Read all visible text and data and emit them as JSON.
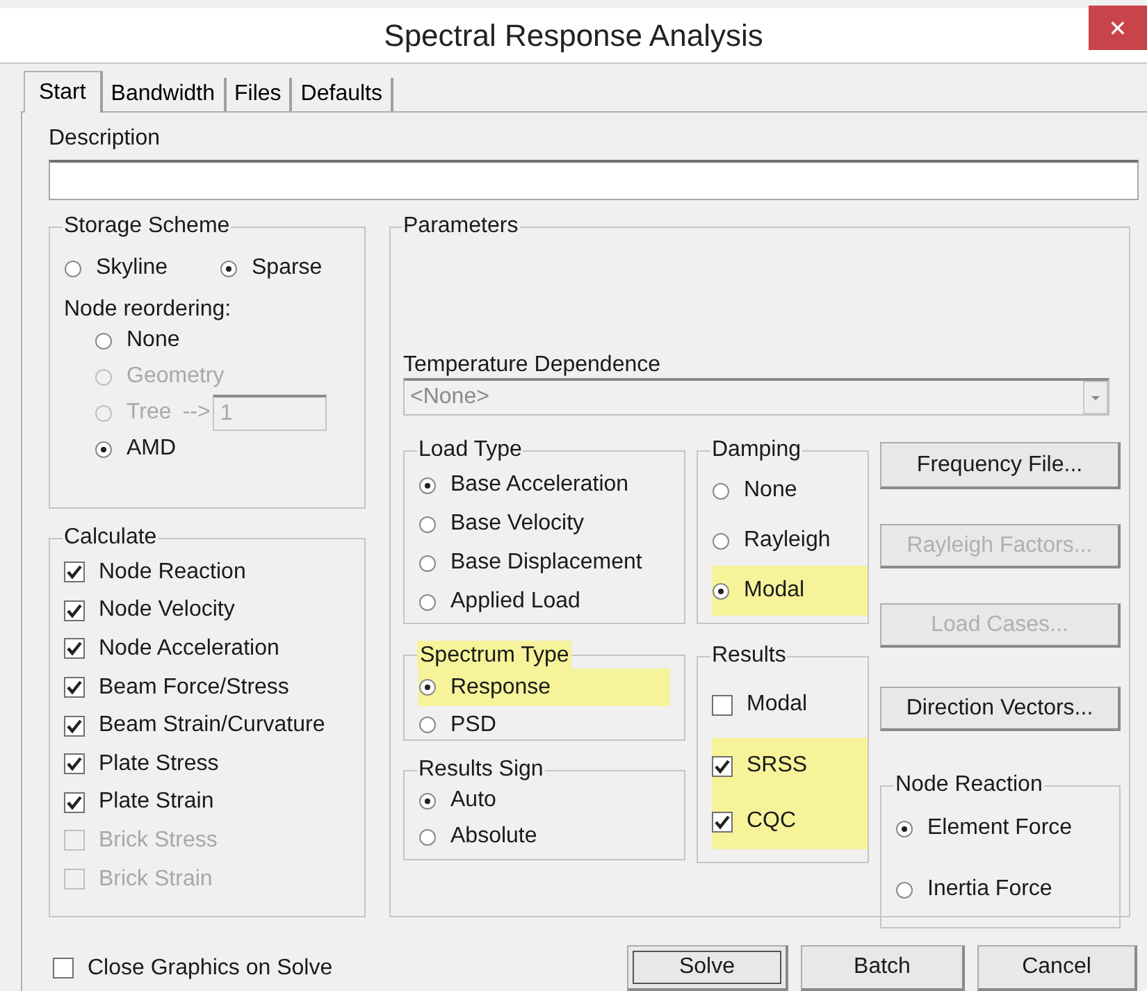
{
  "window": {
    "title": "Spectral Response Analysis",
    "close": "✕"
  },
  "tabs": [
    {
      "label": "Start",
      "selected": true
    },
    {
      "label": "Bandwidth",
      "selected": false
    },
    {
      "label": "Files",
      "selected": false
    },
    {
      "label": "Defaults",
      "selected": false
    }
  ],
  "description": {
    "label": "Description"
  },
  "storage_scheme": {
    "title": "Storage Scheme",
    "options": [
      {
        "label": "Skyline",
        "selected": false
      },
      {
        "label": "Sparse",
        "selected": true
      }
    ],
    "node_reordering": {
      "label": "Node reordering:",
      "options": [
        {
          "label": "None",
          "selected": false,
          "disabled": false
        },
        {
          "label": "Geometry",
          "selected": false,
          "disabled": true
        },
        {
          "label": "Tree",
          "selected": false,
          "disabled": true,
          "arrow": "-->",
          "value": "1"
        },
        {
          "label": "AMD",
          "selected": true,
          "disabled": false
        }
      ]
    }
  },
  "calculate": {
    "title": "Calculate",
    "items": [
      {
        "label": "Node Reaction",
        "checked": true,
        "disabled": false
      },
      {
        "label": "Node Velocity",
        "checked": true,
        "disabled": false
      },
      {
        "label": "Node Acceleration",
        "checked": true,
        "disabled": false
      },
      {
        "label": "Beam Force/Stress",
        "checked": true,
        "disabled": false
      },
      {
        "label": "Beam Strain/Curvature",
        "checked": true,
        "disabled": false
      },
      {
        "label": "Plate Stress",
        "checked": true,
        "disabled": false
      },
      {
        "label": "Plate Strain",
        "checked": true,
        "disabled": false
      },
      {
        "label": "Brick Stress",
        "checked": false,
        "disabled": true
      },
      {
        "label": "Brick Strain",
        "checked": false,
        "disabled": true
      }
    ]
  },
  "parameters": {
    "title": "Parameters",
    "temperature_dependence": {
      "label": "Temperature Dependence",
      "value": "<None>",
      "disabled": true
    },
    "load_type": {
      "title": "Load Type",
      "options": [
        {
          "label": "Base Acceleration",
          "selected": true
        },
        {
          "label": "Base Velocity",
          "selected": false
        },
        {
          "label": "Base Displacement",
          "selected": false
        },
        {
          "label": "Applied Load",
          "selected": false
        }
      ]
    },
    "spectrum_type": {
      "title": "Spectrum Type",
      "options": [
        {
          "label": "Response",
          "selected": true,
          "highlighted": true
        },
        {
          "label": "PSD",
          "selected": false,
          "highlighted": false
        }
      ]
    },
    "results_sign": {
      "title": "Results Sign",
      "options": [
        {
          "label": "Auto",
          "selected": true
        },
        {
          "label": "Absolute",
          "selected": false
        }
      ]
    },
    "damping": {
      "title": "Damping",
      "options": [
        {
          "label": "None",
          "selected": false,
          "highlighted": false
        },
        {
          "label": "Rayleigh",
          "selected": false,
          "highlighted": false
        },
        {
          "label": "Modal",
          "selected": true,
          "highlighted": true
        }
      ]
    },
    "results": {
      "title": "Results",
      "items": [
        {
          "label": "Modal",
          "checked": false,
          "highlighted": false
        },
        {
          "label": "SRSS",
          "checked": true,
          "highlighted": true
        },
        {
          "label": "CQC",
          "checked": true,
          "highlighted": true
        }
      ]
    },
    "buttons": [
      {
        "label": "Frequency File...",
        "disabled": false
      },
      {
        "label": "Rayleigh Factors...",
        "disabled": true
      },
      {
        "label": "Load Cases...",
        "disabled": true
      },
      {
        "label": "Direction Vectors...",
        "disabled": false
      }
    ],
    "node_reaction": {
      "title": "Node Reaction",
      "options": [
        {
          "label": "Element Force",
          "selected": true
        },
        {
          "label": "Inertia Force",
          "selected": false
        }
      ]
    }
  },
  "close_graphics": {
    "label": "Close Graphics on Solve",
    "checked": false
  },
  "footer_buttons": [
    {
      "label": "Solve",
      "focused": true
    },
    {
      "label": "Batch",
      "focused": false
    },
    {
      "label": "Cancel",
      "focused": false
    }
  ]
}
